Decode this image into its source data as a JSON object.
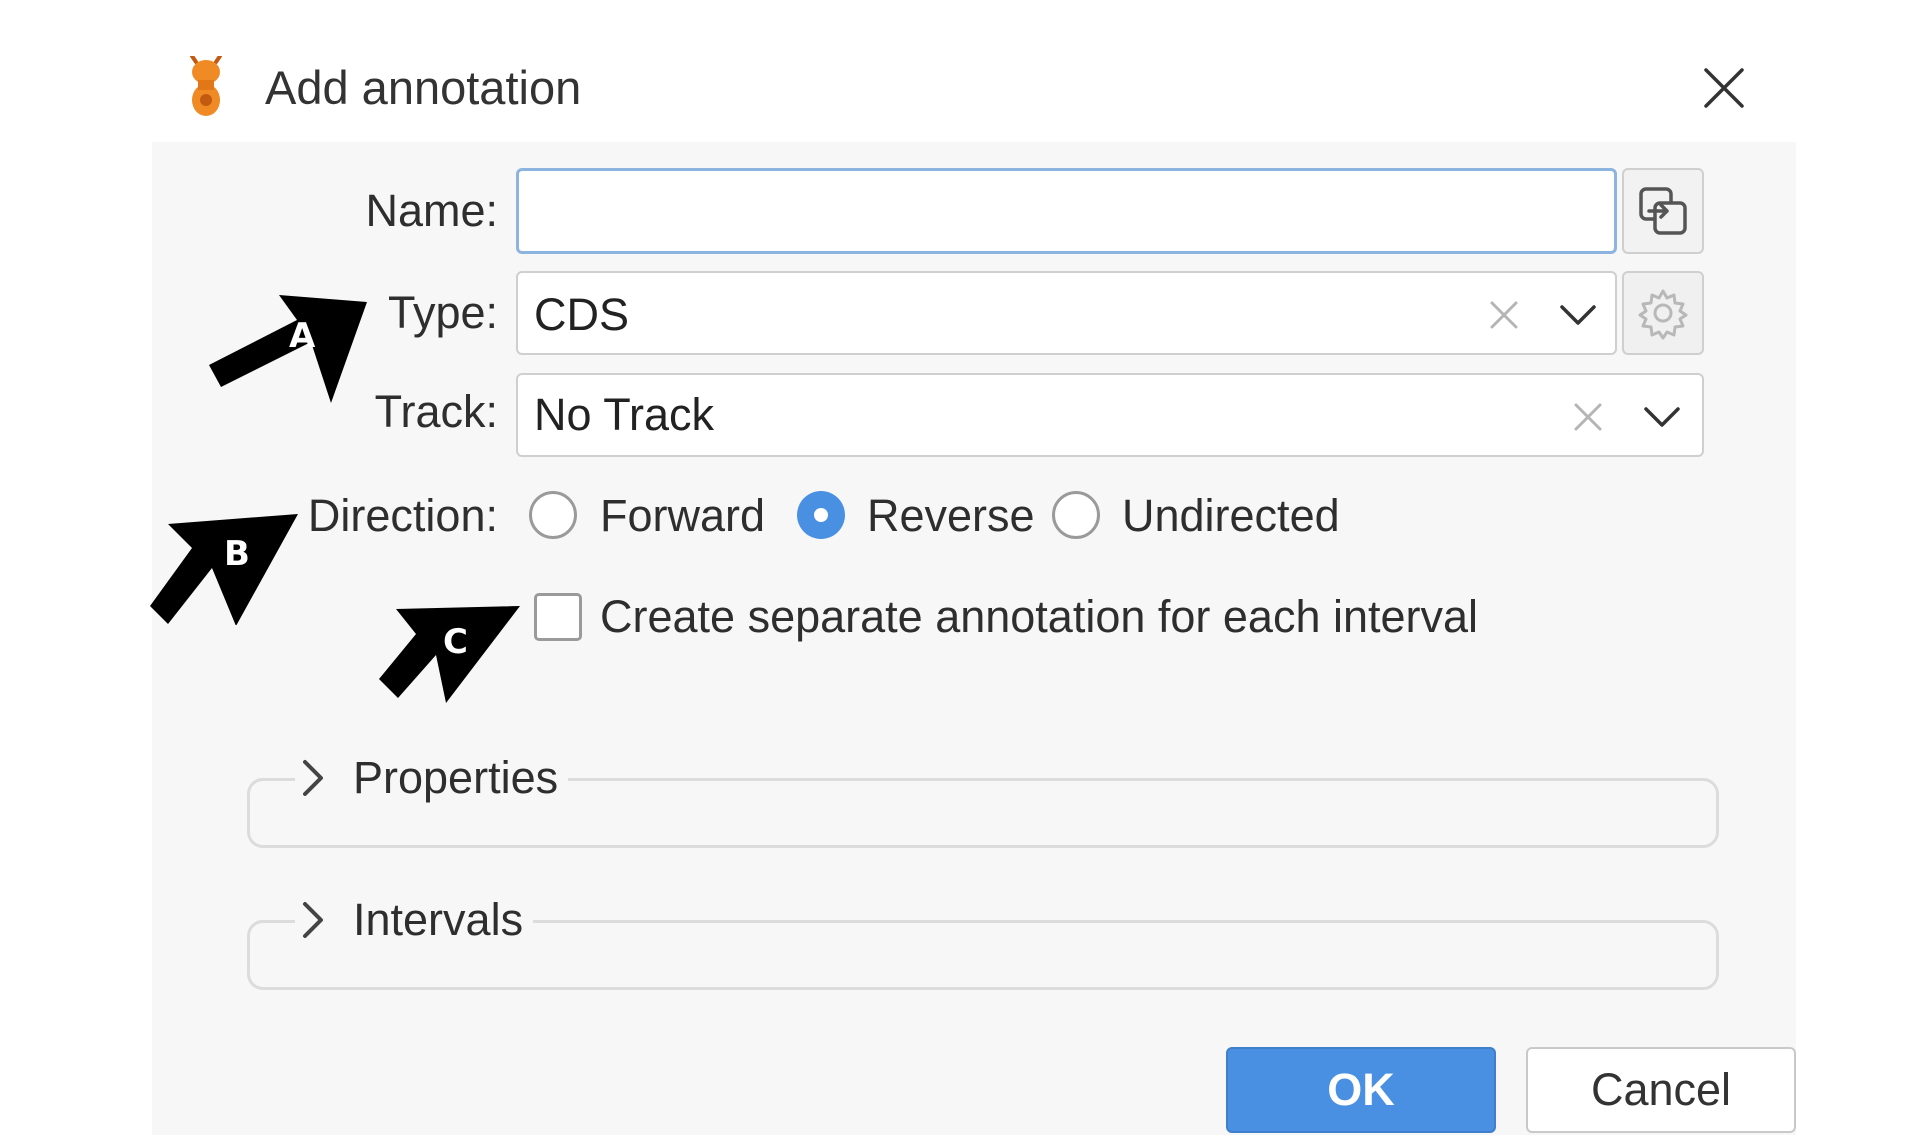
{
  "dialog": {
    "title": "Add annotation",
    "name_label": "Name:",
    "name_value": "",
    "type_label": "Type:",
    "type_value": "CDS",
    "track_label": "Track:",
    "track_value": "No Track",
    "direction_label": "Direction:",
    "direction_options": [
      "Forward",
      "Reverse",
      "Undirected"
    ],
    "direction_selected": "Reverse",
    "separate_checkbox_label": "Create separate annotation for each interval",
    "separate_checkbox_checked": false,
    "sections": [
      "Properties",
      "Intervals"
    ],
    "ok_label": "OK",
    "cancel_label": "Cancel"
  },
  "callouts": [
    "A",
    "B",
    "C"
  ],
  "colors": {
    "accent": "#4a90e2",
    "focus_border": "#8db4de",
    "panel_bg": "#f7f7f7",
    "callout": "#000000"
  },
  "icons": [
    "app-logo-icon",
    "close-icon",
    "copy-to-name-icon",
    "clear-icon",
    "chevron-down-icon",
    "gear-icon",
    "chevron-right-icon",
    "callout-arrow-icon"
  ]
}
